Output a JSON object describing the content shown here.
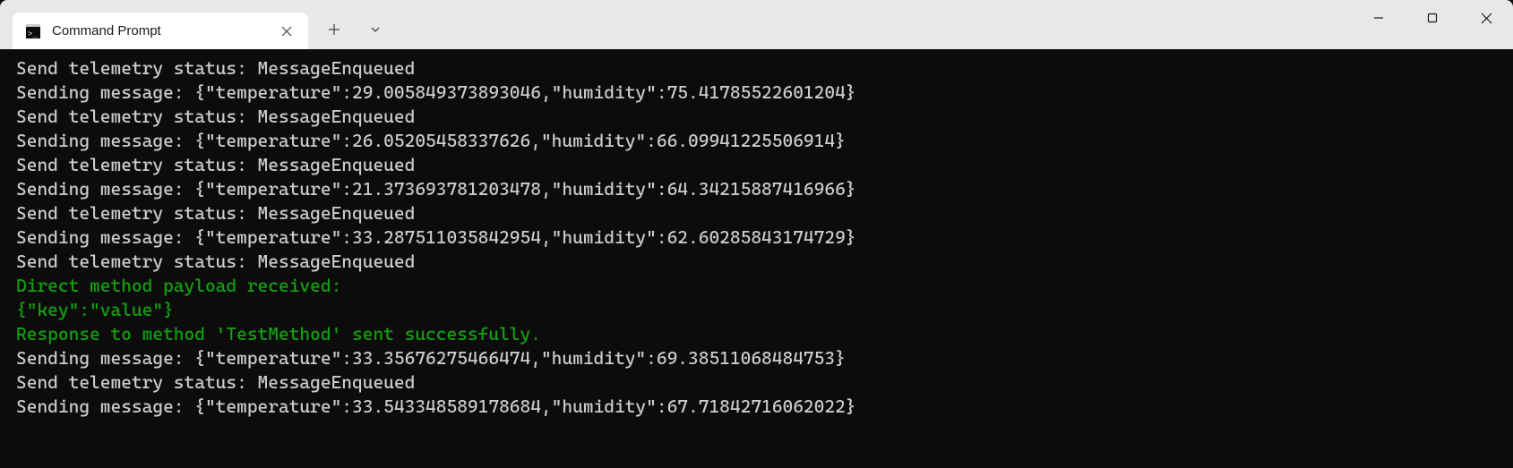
{
  "tab": {
    "title": "Command Prompt"
  },
  "terminal": {
    "lines": [
      {
        "text": "Send telemetry status: MessageEnqueued",
        "color": "default"
      },
      {
        "text": "Sending message: {\"temperature\":29.005849373893046,\"humidity\":75.41785522601204}",
        "color": "default"
      },
      {
        "text": "Send telemetry status: MessageEnqueued",
        "color": "default"
      },
      {
        "text": "Sending message: {\"temperature\":26.05205458337626,\"humidity\":66.09941225506914}",
        "color": "default"
      },
      {
        "text": "Send telemetry status: MessageEnqueued",
        "color": "default"
      },
      {
        "text": "Sending message: {\"temperature\":21.373693781203478,\"humidity\":64.34215887416966}",
        "color": "default"
      },
      {
        "text": "Send telemetry status: MessageEnqueued",
        "color": "default"
      },
      {
        "text": "Sending message: {\"temperature\":33.287511035842954,\"humidity\":62.60285843174729}",
        "color": "default"
      },
      {
        "text": "Send telemetry status: MessageEnqueued",
        "color": "default"
      },
      {
        "text": "Direct method payload received:",
        "color": "green"
      },
      {
        "text": "{\"key\":\"value\"}",
        "color": "green"
      },
      {
        "text": "Response to method 'TestMethod' sent successfully.",
        "color": "green"
      },
      {
        "text": "Sending message: {\"temperature\":33.35676275466474,\"humidity\":69.38511068484753}",
        "color": "default"
      },
      {
        "text": "Send telemetry status: MessageEnqueued",
        "color": "default"
      },
      {
        "text": "Sending message: {\"temperature\":33.543348589178684,\"humidity\":67.71842716062022}",
        "color": "default"
      }
    ]
  }
}
